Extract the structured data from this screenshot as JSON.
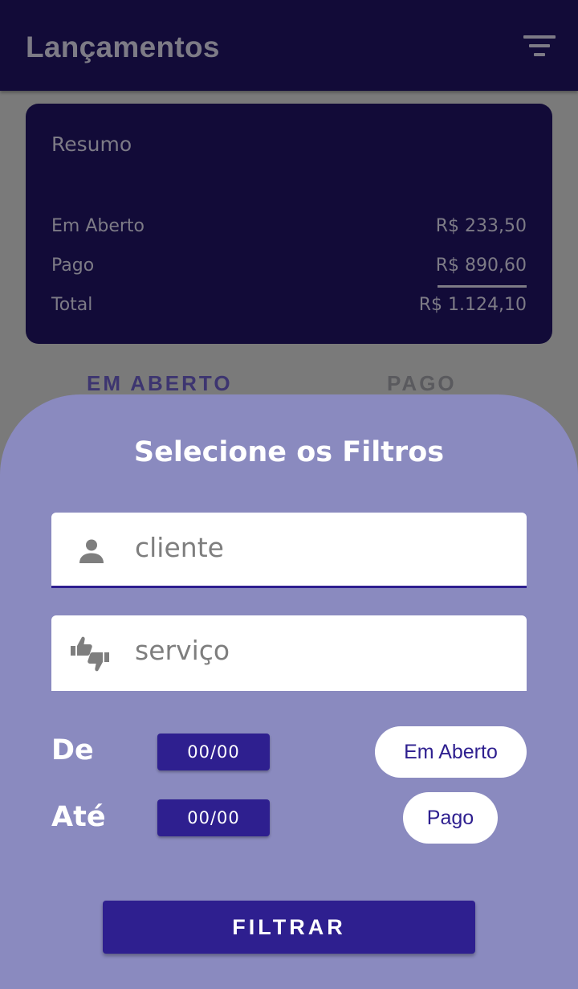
{
  "appbar": {
    "title": "Lançamentos",
    "filter_icon": "filter-list-icon"
  },
  "summary": {
    "title": "Resumo",
    "rows": [
      {
        "label": "Em Aberto",
        "value": "R$ 233,50"
      },
      {
        "label": "Pago",
        "value": "R$ 890,60"
      },
      {
        "label": "Total",
        "value": "R$ 1.124,10"
      }
    ]
  },
  "tabs": [
    {
      "label": "EM ABERTO",
      "selected": true
    },
    {
      "label": "PAGO",
      "selected": false
    }
  ],
  "filter_sheet": {
    "title": "Selecione os Filtros",
    "client_field": {
      "placeholder": "cliente",
      "icon": "person-icon"
    },
    "service_field": {
      "placeholder": "serviço",
      "icon": "thumbs-up-down-icon"
    },
    "date_from": {
      "label": "De",
      "value": "00/00"
    },
    "date_to": {
      "label": "Até",
      "value": "00/00"
    },
    "status_chips": [
      "Em Aberto",
      "Pago"
    ],
    "submit_label": "FILTRAR"
  },
  "colors": {
    "primary_dark": "#120b38",
    "primary": "#2e1f8f",
    "sheet_background": "#8a8abf"
  }
}
